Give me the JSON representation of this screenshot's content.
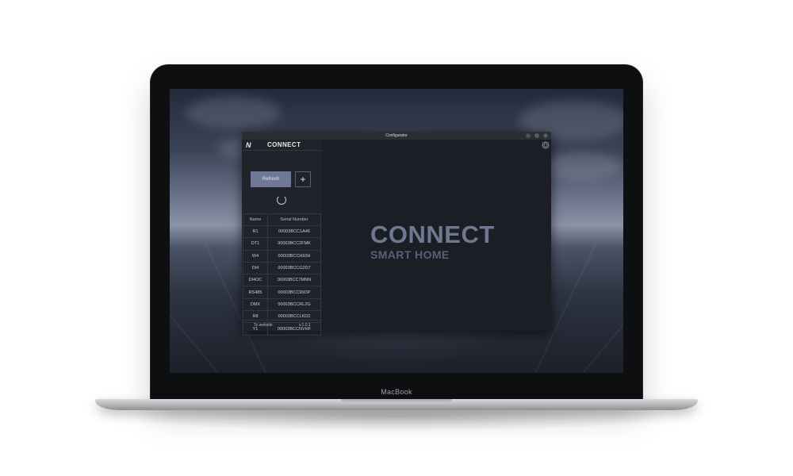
{
  "device": {
    "brand_label": "MacBook"
  },
  "window": {
    "title": "Configurator",
    "controls": {
      "minimize": "–",
      "maximize": "◻",
      "close": "×"
    }
  },
  "sidebar": {
    "logo_icon": "N",
    "title": "CONNECT",
    "refresh_label": "Refresh",
    "add_label": "+",
    "table": {
      "headers": [
        "Name",
        "Serial Number"
      ],
      "rows": [
        [
          "R1",
          "00003BCC1A46"
        ],
        [
          "DT1",
          "00003BCC2FMK"
        ],
        [
          "W4",
          "00003BCCH93H"
        ],
        [
          "DI4",
          "00003BCCG2D7"
        ],
        [
          "DI4OC",
          "00003BCC7MNN"
        ],
        [
          "RS485",
          "00003BCC90OP"
        ],
        [
          "DMX",
          "00003BCCRL2G"
        ],
        [
          "R8",
          "00003BCCLKD2"
        ],
        [
          "Y1",
          "00003BCCNVHF"
        ]
      ]
    },
    "footer": {
      "to_website": "To website",
      "version": "v.1.0.1"
    }
  },
  "main": {
    "hero_title": "CONNECT",
    "hero_subtitle": "SMART HOME",
    "settings_icon": "gear-icon"
  },
  "colors": {
    "refresh_button": "#6f7897",
    "hero_title": "#6e7891",
    "hero_subtitle": "#56607a",
    "window_bg": "#1b1e24"
  }
}
